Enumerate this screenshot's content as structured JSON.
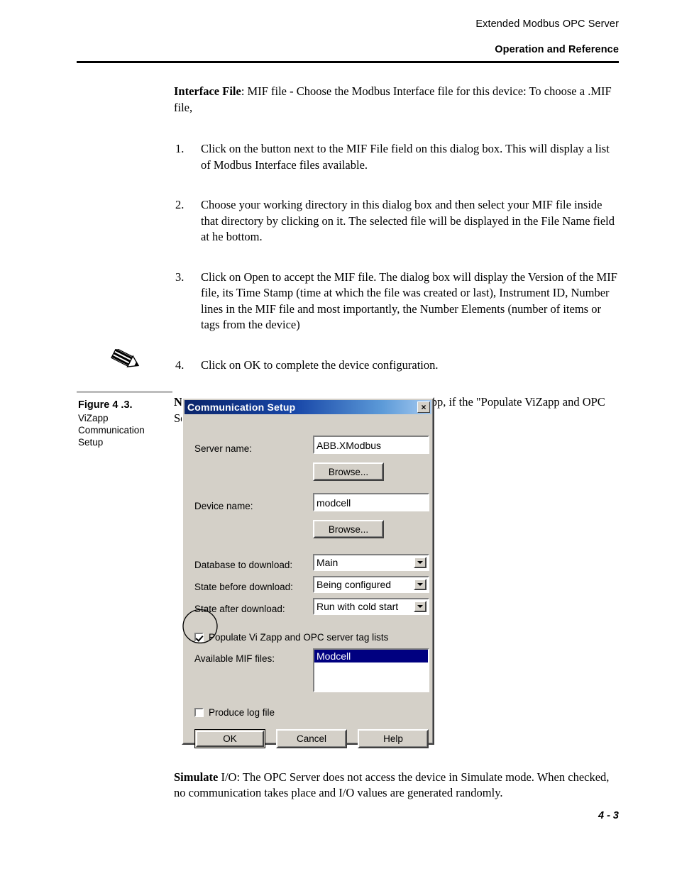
{
  "header": {
    "product": "Extended Modbus OPC Server",
    "section": "Operation and Reference"
  },
  "content": {
    "intro_bold": "Interface File",
    "intro_rest": ": MIF file - Choose the Modbus Interface file for this device: To choose a .MIF file,",
    "steps": [
      {
        "num": "1.",
        "text": "Click on the button next to the MIF File field on this dialog box. This will display a list of Modbus Interface files available."
      },
      {
        "num": "2.",
        "text": "Choose your working directory in this dialog box and then select your MIF file inside that directory by clicking on it. The selected file will be displayed in the File Name field at he bottom."
      },
      {
        "num": "3.",
        "text": "Click on Open to accept the MIF file. The dialog box will display the Version of the MIF file, its Time Stamp (time at which the file was created or last), Instrument ID, Number lines in the MIF file and most importantly, the Number Elements (number of items or tags from the device)"
      },
      {
        "num": "4.",
        "text": "Click on OK to complete the device configuration."
      }
    ],
    "note_bold": "Note:",
    "note_rest": " This field will be automatically filled in by ViZapp, if the \"Populate ViZapp and OPC Server tag lists\" box is checked when downloading.",
    "footer_bold": "Simulate",
    "footer_rest": " I/O: The OPC Server does not access the device in Simulate mode. When checked, no communication takes place and I/O values are generated randomly."
  },
  "figure": {
    "title": "Figure 4 .3.",
    "line1": "ViZapp",
    "line2": "Communication",
    "line3": "Setup"
  },
  "dialog": {
    "title": "Communication Setup",
    "close_label": "×",
    "server_name_label": "Server name:",
    "server_name_value": "ABB.XModbus",
    "server_browse_label": "Browse...",
    "device_name_label": "Device name:",
    "device_name_value": "modcell",
    "device_browse_label": "Browse...",
    "database_label": "Database to download:",
    "database_value": "Main",
    "state_before_label": "State before download:",
    "state_before_value": "Being configured",
    "state_after_label": "State after download:",
    "state_after_value": "Run with cold start",
    "populate_label": "Populate Vi Zapp and OPC server tag lists",
    "populate_checked": true,
    "mif_label": "Available MIF files:",
    "mif_items": [
      "Modcell"
    ],
    "log_label": "Produce log file",
    "log_checked": false,
    "ok_label": "OK",
    "cancel_label": "Cancel",
    "help_label": "Help"
  },
  "colors": {
    "titlebar_start": "#0a246a",
    "titlebar_end": "#a6caf0",
    "dialog_face": "#d4d0c8",
    "selection": "#000080"
  },
  "page_number": "4 - 3"
}
